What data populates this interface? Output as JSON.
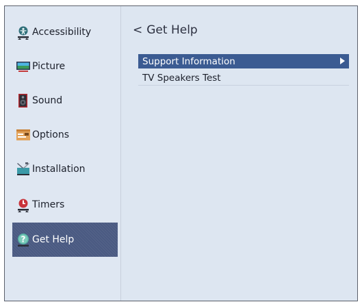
{
  "sidebar": {
    "items": [
      {
        "label": "Accessibility",
        "icon": "accessibility-icon"
      },
      {
        "label": "Picture",
        "icon": "picture-icon"
      },
      {
        "label": "Sound",
        "icon": "sound-icon"
      },
      {
        "label": "Options",
        "icon": "options-icon"
      },
      {
        "label": "Installation",
        "icon": "installation-icon"
      },
      {
        "label": "Timers",
        "icon": "timers-icon"
      },
      {
        "label": "Get Help",
        "icon": "get-help-icon",
        "selected": true
      }
    ]
  },
  "main": {
    "title": "Get Help",
    "back_glyph": "<",
    "options": [
      {
        "label": "Support Information",
        "selected": true
      },
      {
        "label": "TV Speakers Test"
      }
    ]
  },
  "colors": {
    "background": "#dfe7f2",
    "sidebar_selected": "#4a5a82",
    "menu_selected": "#3b5b92",
    "text": "#1b1f2a"
  }
}
